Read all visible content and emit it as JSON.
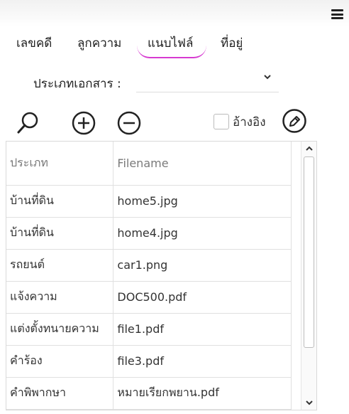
{
  "menu": {
    "icon": "hamburger-icon"
  },
  "tabs": [
    {
      "label": "เลขคดี"
    },
    {
      "label": "ลูกความ"
    },
    {
      "label": "แนบไฟล์",
      "active": true
    },
    {
      "label": "ที่อยู่"
    }
  ],
  "filter": {
    "doc_type_label": "ประเภทเอกสาร :",
    "doc_type_value": ""
  },
  "toolbar": {
    "icons": [
      "search-icon",
      "plus-circle-icon",
      "minus-circle-icon",
      "edit-icon"
    ],
    "reference_label": "อ้างอิง",
    "reference_checked": false
  },
  "table": {
    "headers": [
      "ประเภท",
      "Filename"
    ],
    "rows": [
      [
        "บ้านที่ดิน",
        "home5.jpg"
      ],
      [
        "บ้านที่ดิน",
        "home4.jpg"
      ],
      [
        "รถยนต์",
        "car1.png"
      ],
      [
        "แจ้งความ",
        "DOC500.pdf"
      ],
      [
        "แต่งตั้งทนายความ",
        "file1.pdf"
      ],
      [
        "คำร้อง",
        "file3.pdf"
      ],
      [
        "คำพิพากษา",
        "หมายเรียกพยาน.pdf"
      ]
    ]
  },
  "colors": {
    "accent": "#d63ad0"
  }
}
